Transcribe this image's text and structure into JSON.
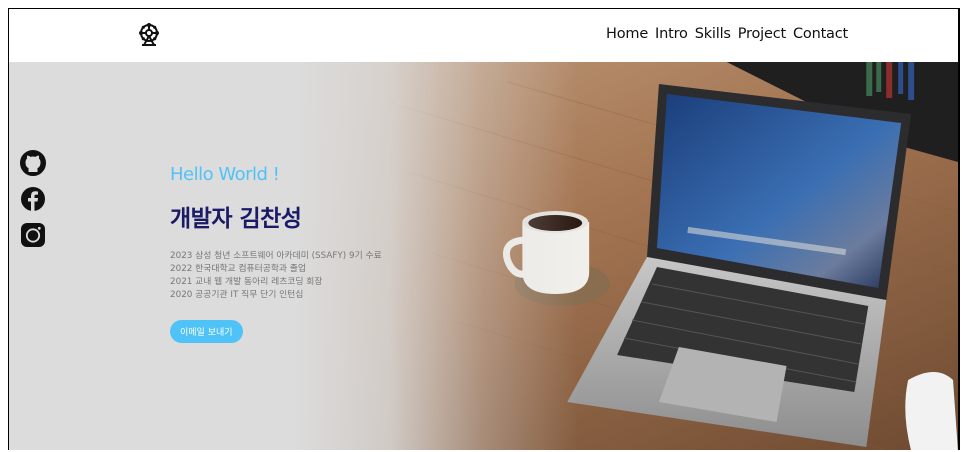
{
  "header": {
    "logo_icon": "ferris-wheel-icon",
    "nav": [
      {
        "label": "Home"
      },
      {
        "label": "Intro"
      },
      {
        "label": "Skills"
      },
      {
        "label": "Project"
      },
      {
        "label": "Contact"
      }
    ]
  },
  "social": [
    {
      "icon": "github-icon"
    },
    {
      "icon": "facebook-icon"
    },
    {
      "icon": "instagram-icon"
    }
  ],
  "hero": {
    "greeting": "Hello World !",
    "name": "개발자 김찬성",
    "bio": [
      "2023 삼성 청년 소프트웨어 아카데미 (SSAFY) 9기 수료",
      "2022 한국대학교 컴퓨터공학과 졸업",
      "2021 교내 웹 개발 동아리 레츠코딩 회장",
      "2020 공공기관 IT 직무 단기 인턴십"
    ],
    "email_button": "이메일 보내기"
  },
  "colors": {
    "accent": "#4fc3f7",
    "name": "#1a1a66"
  }
}
